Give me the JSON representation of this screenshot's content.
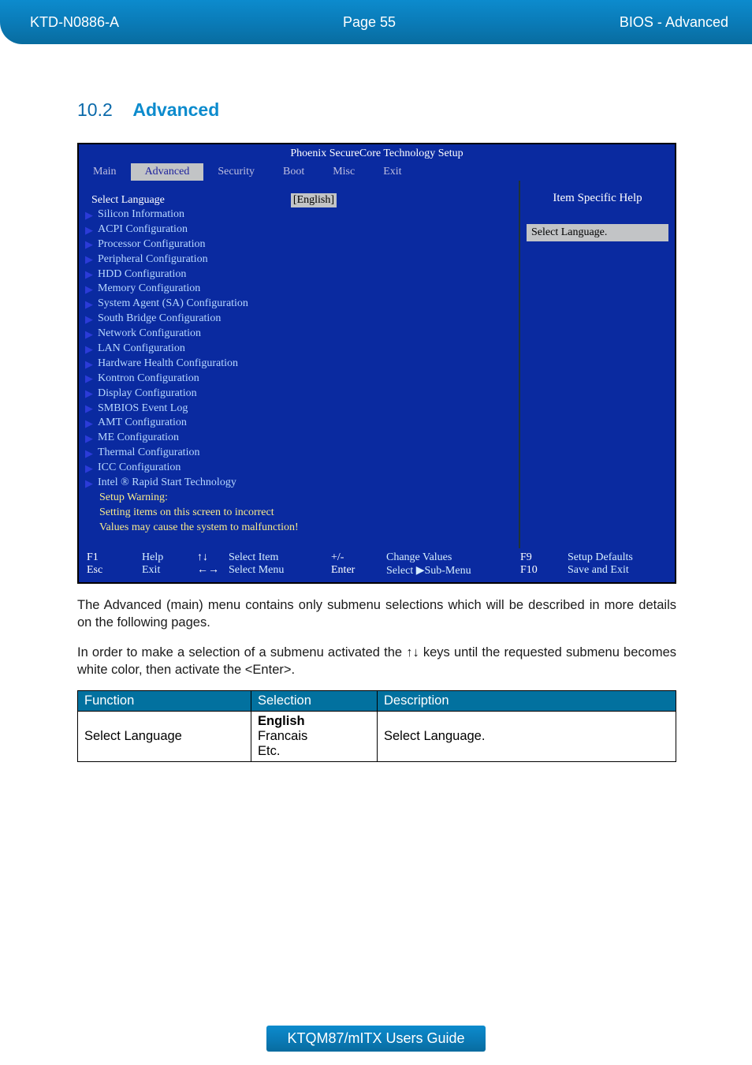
{
  "header": {
    "left": "KTD-N0886-A",
    "mid": "Page 55",
    "right": "BIOS  - Advanced"
  },
  "section": {
    "number": "10.2",
    "title": "Advanced"
  },
  "bios": {
    "title": "Phoenix SecureCore Technology Setup",
    "tabs": [
      "Main",
      "Advanced",
      "Security",
      "Boot",
      "Misc",
      "Exit"
    ],
    "active_tab": "Advanced",
    "select_label": "Select Language",
    "select_value": "[English]",
    "submenus": [
      "Silicon Information",
      "ACPI Configuration",
      "Processor Configuration",
      "Peripheral Configuration",
      "HDD Configuration",
      "Memory Configuration",
      "System Agent (SA)  Configuration",
      "South Bridge Configuration",
      "Network Configuration",
      "LAN Configuration",
      "Hardware Health Configuration",
      "Kontron Configuration",
      "Display Configuration",
      "SMBIOS Event Log",
      "AMT Configuration",
      "ME Configuration",
      "Thermal Configuration",
      "ICC Configuration",
      "Intel ® Rapid Start Technology"
    ],
    "warning": [
      "Setup Warning:",
      "Setting items on this screen to incorrect",
      "Values may cause the system to malfunction!"
    ],
    "help": {
      "title": "Item Specific Help",
      "text": "Select Language."
    },
    "footer": {
      "f1": "F1",
      "help": "Help",
      "ud": "↑↓",
      "sel_item": "Select Item",
      "pm": "+/-",
      "cv": "Change Values",
      "f9": "F9",
      "sd": "Setup Defaults",
      "esc": "Esc",
      "exit": "Exit",
      "lr": "←→",
      "sel_menu": "Select Menu",
      "enter": "Enter",
      "subm": "Select ▶Sub-Menu",
      "f10": "F10",
      "se": "Save and Exit"
    }
  },
  "paragraph1": "The Advanced (main) menu contains only submenu selections which will be described in more details on the following pages.",
  "paragraph2": "In order to make a selection of a submenu activated the ↑↓ keys until the requested submenu becomes white color, then activate the <Enter>.",
  "table": {
    "headers": [
      "Function",
      "Selection",
      "Description"
    ],
    "rows": [
      {
        "function": "Select Language",
        "selection": "English\nFrancais\nEtc.",
        "description": "Select Language."
      }
    ]
  },
  "footer": {
    "text": "KTQM87/mITX Users Guide"
  }
}
